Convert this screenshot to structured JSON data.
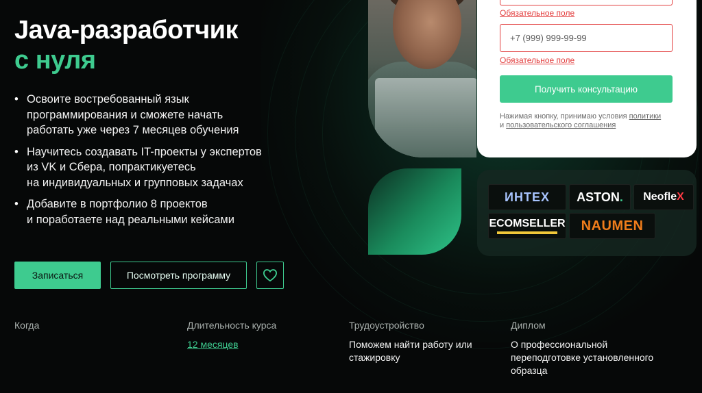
{
  "hero": {
    "title_line1": "Java-разработчик",
    "title_line2": "с нуля"
  },
  "benefits": [
    {
      "lines": [
        "Освоите востребованный язык",
        "программирования и сможете начать",
        "работать уже через 7 месяцев обучения"
      ]
    },
    {
      "lines": [
        "Научитесь создавать IT-проекты у экспертов",
        "из VK и Сбера, попрактикуетесь",
        "на индивидуальных и групповых задачах"
      ]
    },
    {
      "lines": [
        "Добавите в портфолио 8 проектов",
        "и поработаете над реальными кейсами"
      ]
    }
  ],
  "actions": {
    "signup_label": "Записаться",
    "program_label": "Посмотреть программу",
    "favorite_icon": "heart-icon"
  },
  "info": {
    "when": {
      "label": "Когда",
      "value": ""
    },
    "duration": {
      "label": "Длительность курса",
      "value": "12 месяцев"
    },
    "employment": {
      "label": "Трудоустройство",
      "value": "Поможем найти работу или стажировку"
    },
    "diploma": {
      "label": "Диплом",
      "value": "О профессиональной переподготовке установленного образца"
    }
  },
  "form": {
    "error_required": "Обязательное поле",
    "phone_placeholder": "+7 (999) 999-99-99",
    "consult_label": "Получить консультацию",
    "consent_text": "Нажимая кнопку, принимаю условия",
    "consent_link_policy": "политики",
    "consent_and": "и",
    "consent_link_agreement": "пользовательского соглашения"
  },
  "partners": {
    "intex": "ИНТЕХ",
    "aston": "ASTON",
    "aston_dot": ".",
    "neoflex": "Neofle",
    "neoflex_x": "X",
    "ecomseller": "ECOMSELLER",
    "naumen": "NAUMEN"
  },
  "colors": {
    "accent": "#3ecb8f",
    "background": "#060808",
    "error": "#e23c3c"
  }
}
